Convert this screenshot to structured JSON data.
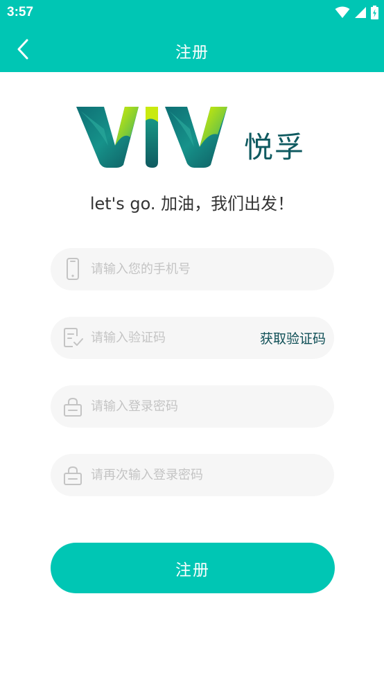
{
  "status_bar": {
    "time": "3:57"
  },
  "app_bar": {
    "title": "注册"
  },
  "brand": {
    "logo_text": "VIV",
    "name_cn": "悦孚"
  },
  "slogan": "let's go. 加油，我们出发！",
  "form": {
    "phone": {
      "placeholder": "请输入您的手机号",
      "value": ""
    },
    "code": {
      "placeholder": "请输入验证码",
      "value": "",
      "get_code_label": "获取验证码"
    },
    "password": {
      "placeholder": "请输入登录密码",
      "value": ""
    },
    "password_confirm": {
      "placeholder": "请再次输入登录密码",
      "value": ""
    },
    "submit_label": "注册"
  },
  "colors": {
    "primary": "#00c6b4",
    "brand_dark": "#0f5a60",
    "field_bg": "#f6f6f6",
    "placeholder": "#c4c4c4"
  },
  "icons": [
    "back-arrow-icon",
    "wifi-icon",
    "signal-icon",
    "battery-icon",
    "phone-icon",
    "verify-code-icon",
    "lock-icon"
  ]
}
